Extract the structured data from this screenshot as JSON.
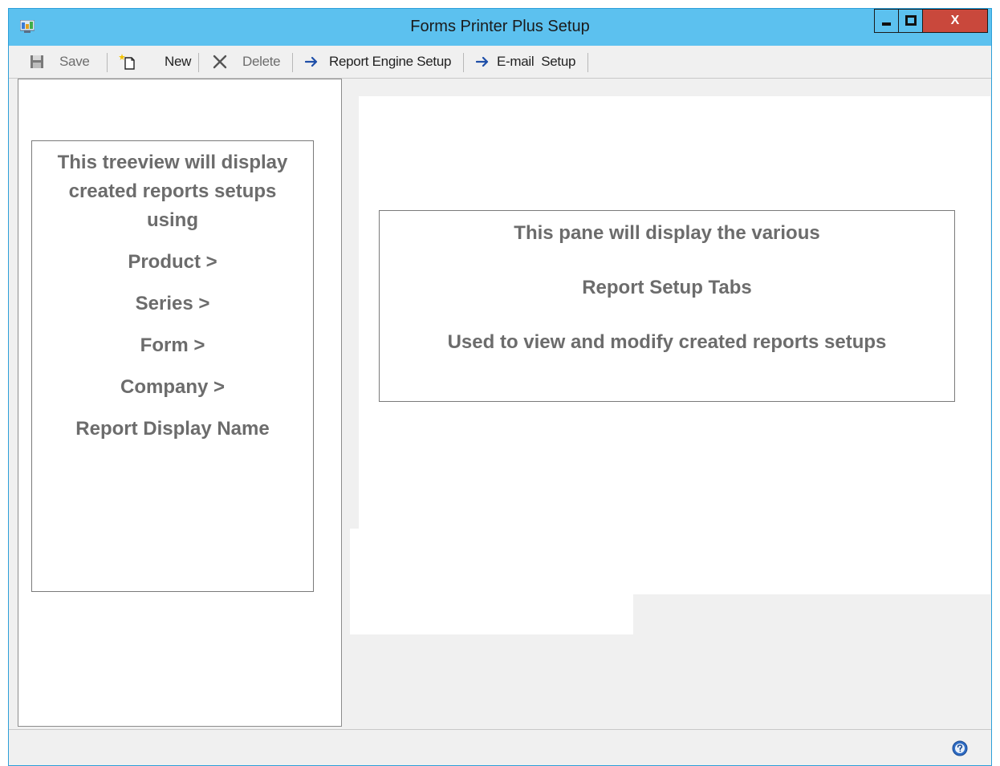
{
  "window": {
    "title": "Forms Printer Plus Setup",
    "close_label": "X"
  },
  "toolbar": {
    "save_label": "Save",
    "new_label": "New",
    "delete_label": "Delete",
    "report_engine_label": "Report Engine Setup",
    "email_setup_label": "E-mail  Setup"
  },
  "tree_note": {
    "lines": [
      "This treeview will display",
      "created reports setups",
      "using",
      "Product >",
      "Series >",
      "Form >",
      "Company >",
      "Report Display Name"
    ]
  },
  "pane_note": {
    "lines": [
      "This pane will display the various",
      "Report Setup Tabs",
      "Used to view and modify created reports setups"
    ]
  },
  "colors": {
    "titlebar": "#5cc1ef",
    "close_button": "#c9483c",
    "note_text": "#6c6c6c",
    "arrow_blue": "#1f4fa8"
  },
  "icons": {
    "app": "app-icon",
    "save": "floppy-disk-icon",
    "new": "new-document-icon",
    "delete": "x-delete-icon",
    "report_engine": "arrow-right-icon",
    "email": "arrow-right-icon",
    "help": "help-icon"
  }
}
